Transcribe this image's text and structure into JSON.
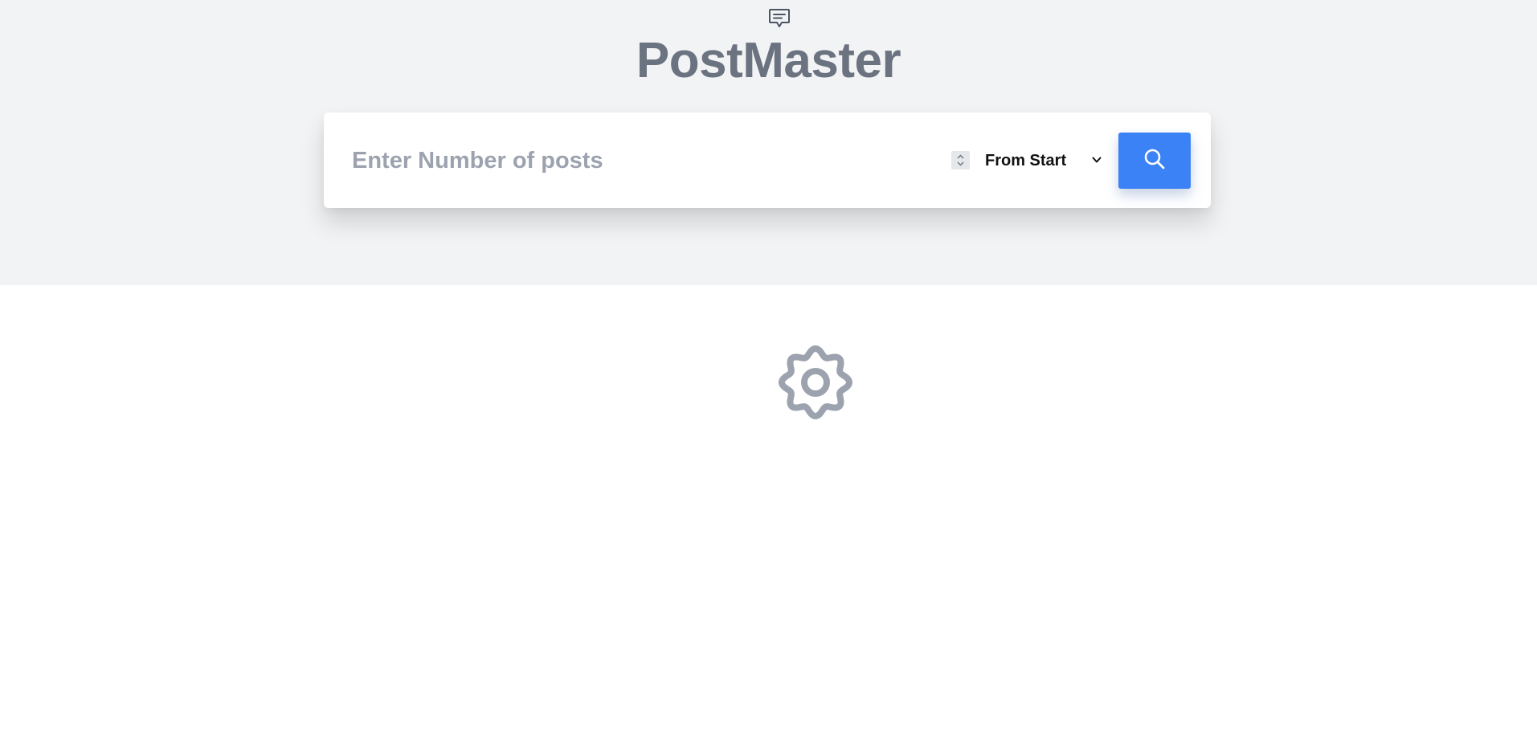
{
  "app": {
    "title": "PostMaster",
    "logo_icon": "chat-bubble-icon"
  },
  "search": {
    "placeholder": "Enter Number of posts",
    "value": "",
    "order_selected": "From Start",
    "order_icon": "chevron-down-icon",
    "button_icon": "search-icon"
  },
  "content": {
    "status_icon": "gear-icon"
  },
  "colors": {
    "header_bg": "#f2f3f5",
    "title": "#6b7280",
    "accent": "#3b82f6",
    "placeholder": "#9ca3af",
    "gear": "#9ca3af"
  }
}
